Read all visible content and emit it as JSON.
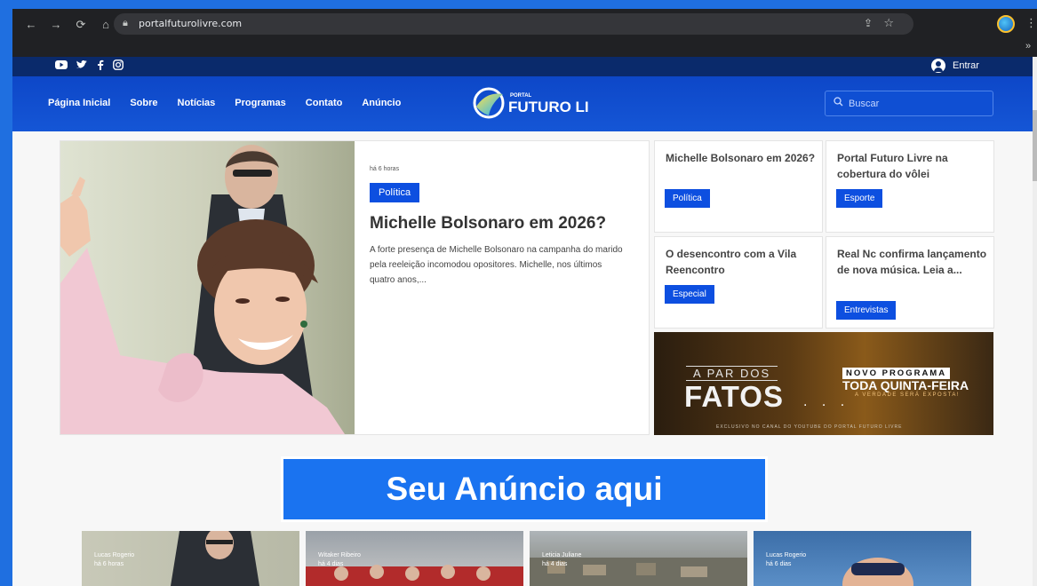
{
  "browser": {
    "url": "portalfuturolivre.com",
    "nav_icons": [
      "back-icon",
      "forward-icon",
      "reload-icon",
      "home-icon"
    ]
  },
  "header": {
    "social": [
      "youtube-icon",
      "twitter-icon",
      "facebook-icon",
      "instagram-icon"
    ],
    "login_label": "Entrar",
    "menu": [
      "Página Inicial",
      "Sobre",
      "Notícias",
      "Programas",
      "Contato",
      "Anúncio"
    ],
    "logo_small": "PORTAL",
    "logo_big": "FUTURO LIVRE",
    "search_placeholder": "Buscar"
  },
  "hero": {
    "time": "há 6 horas",
    "category": "Política",
    "title": "Michelle Bolsonaro em 2026?",
    "description": "A forte presença de Michelle Bolsonaro na campanha do marido pela reeleição incomodou opositores. Michelle, nos últimos quatro anos,..."
  },
  "side_cards": [
    {
      "title": "Michelle Bolsonaro em 2026?",
      "category": "Política"
    },
    {
      "title": "Portal Futuro Livre na cobertura do vôlei",
      "category": "Esporte"
    },
    {
      "title": "O desencontro com a Vila Reencontro",
      "category": "Especial"
    },
    {
      "title": "Real Nc confirma lançamento de nova música. Leia a...",
      "category": "Entrevistas"
    }
  ],
  "banner": {
    "line1": "A PAR DOS",
    "line2": "FATOS",
    "dots": ". . .",
    "novo": "NOVO PROGRAMA",
    "quinta": "TODA QUINTA-FEIRA",
    "verdade": "A VERDADE SERÁ EXPOSTA!",
    "exclusivo": "EXCLUSIVO NO CANAL DO YOUTUBE DO PORTAL FUTURO LIVRE"
  },
  "ad_slot": "Seu Anúncio aqui",
  "thumbnails": [
    {
      "author": "Lucas Rogerio",
      "time": "há 6 horas"
    },
    {
      "author": "Witaker Ribeiro",
      "time": "há 4 dias"
    },
    {
      "author": "Leticia Juliane",
      "time": "há 4 dias"
    },
    {
      "author": "Lucas Rogerio",
      "time": "há 6 dias"
    }
  ],
  "colors": {
    "brand_blue": "#1556d6",
    "tag_blue": "#0d4fe0",
    "top_bar": "#0a2a6b",
    "ad_blue": "#1a73f0"
  }
}
